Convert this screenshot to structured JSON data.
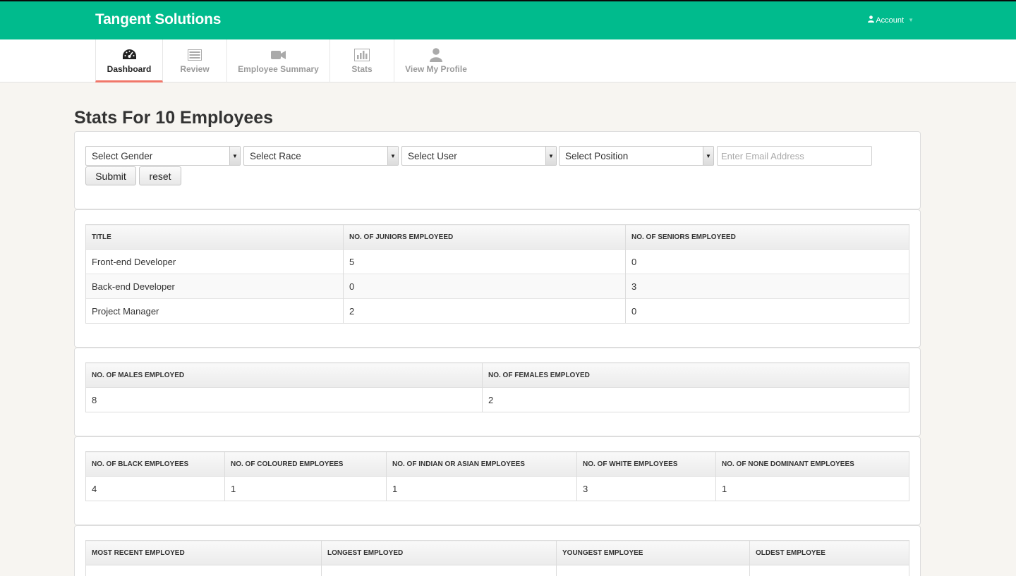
{
  "header": {
    "brand": "Tangent Solutions",
    "account_label": "Account",
    "colors": {
      "topbar": "#00bb8d",
      "active_tab_underline": "#f0776a"
    }
  },
  "nav": {
    "tabs": [
      {
        "label": "Dashboard",
        "icon": "dashboard-gauge-icon",
        "active": true
      },
      {
        "label": "Review",
        "icon": "list-icon",
        "active": false
      },
      {
        "label": "Employee Summary",
        "icon": "video-camera-icon",
        "active": false
      },
      {
        "label": "Stats",
        "icon": "bar-chart-icon",
        "active": false
      },
      {
        "label": "View My Profile",
        "icon": "user-icon",
        "active": false
      }
    ]
  },
  "page": {
    "title": "Stats For 10 Employees"
  },
  "filters": {
    "gender": "Select Gender",
    "race": "Select Race",
    "user": "Select User",
    "position": "Select Position",
    "email_placeholder": "Enter Email Address",
    "submit": "Submit",
    "reset": "reset"
  },
  "tables": {
    "titles": {
      "headers": [
        "TITLE",
        "NO. OF JUNIORS EMPLOYEED",
        "NO. OF SENIORS EMPLOYEED"
      ],
      "rows": [
        [
          "Front-end Developer",
          "5",
          "0"
        ],
        [
          "Back-end Developer",
          "0",
          "3"
        ],
        [
          "Project Manager",
          "2",
          "0"
        ]
      ]
    },
    "gender": {
      "headers": [
        "NO. OF MALES EMPLOYED",
        "NO. OF FEMALES EMPLOYED"
      ],
      "rows": [
        [
          "8",
          "2"
        ]
      ]
    },
    "race": {
      "headers": [
        "NO. OF BLACK EMPLOYEES",
        "NO. OF COLOURED EMPLOYEES",
        "NO. OF INDIAN OR ASIAN EMPLOYEES",
        "NO. OF WHITE EMPLOYEES",
        "NO. OF NONE DOMINANT EMPLOYEES"
      ],
      "rows": [
        [
          "4",
          "1",
          "1",
          "3",
          "1"
        ]
      ]
    },
    "tenure": {
      "headers": [
        "MOST RECENT EMPLOYED",
        "LONGEST EMPLOYED",
        "YOUNGEST EMPLOYEE",
        "OLDEST EMPLOYEE"
      ],
      "rows": []
    }
  }
}
